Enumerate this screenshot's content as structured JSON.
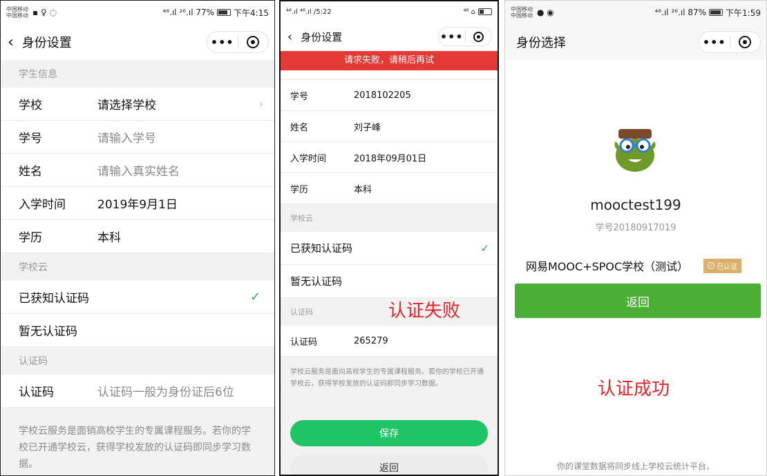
{
  "panel1": {
    "status": {
      "carrier_top": "中国移动",
      "carrier_bottom": "中国移动",
      "right": "⁴⁶.ıl ²⁶.ıl 77%",
      "time": "下午4:15"
    },
    "nav": {
      "title": "身份设置"
    },
    "student_section": {
      "title": "学生信息",
      "school": {
        "label": "学校",
        "value": "请选择学校"
      },
      "student_id": {
        "label": "学号",
        "placeholder": "请输入学号"
      },
      "name": {
        "label": "姓名",
        "placeholder": "请输入真实姓名"
      },
      "enroll": {
        "label": "入学时间",
        "value": "2019年9月1日"
      },
      "degree": {
        "label": "学历",
        "value": "本科"
      }
    },
    "cloud_section": {
      "title": "学校云",
      "option_have": "已获知认证码",
      "option_none": "暂无认证码"
    },
    "code_section": {
      "title": "认证码",
      "label": "认证码",
      "placeholder": "认证码一般为身份证后6位"
    },
    "description": "学校云服务是面销高校学生的专属课程服务。若你的学校已开通学校云，获得学校发放的认证码即同步学习数据。"
  },
  "panel2": {
    "status": {
      "left": "⁴⁶.ıl ⁴⁶.ıl /5:22",
      "right": "⁴⁶ ⌂",
      "time": ""
    },
    "nav": {
      "title": "身份设置"
    },
    "error_message": "请求失败，请稍后再试",
    "student_id": {
      "label": "学号",
      "value": "2018102205"
    },
    "name": {
      "label": "姓名",
      "value": "刘子峰"
    },
    "enroll": {
      "label": "入学时间",
      "value": "2018年09月01日"
    },
    "degree": {
      "label": "学历",
      "value": "本科"
    },
    "cloud_section": {
      "title": "学校云",
      "option_have": "已获知认证码",
      "option_none": "暂无认证码"
    },
    "code_section": {
      "title": "认证码",
      "label": "认证码",
      "value": "265279"
    },
    "description": "学校云服务是面向高校学生的专属课程服务。若你的学校已开通学校云，获得学校发放的认证码即同步学习数据。",
    "save_label": "保存",
    "back_label": "返回",
    "annotation": "认证失败"
  },
  "panel3": {
    "status": {
      "carrier_top": "中国移动",
      "carrier_bottom": "中国移动",
      "right": "⁴⁶.ıl ²⁶.ıl 87%",
      "time": "下午1:59"
    },
    "nav": {
      "title": "身份选择"
    },
    "username": "mooctest199",
    "student_id": "学号20180917019",
    "school": "网易MOOC+SPOC学校（测试）",
    "badge": "已认证",
    "return_label": "返回",
    "annotation": "认证成功",
    "footer": "你的课堂数据将同步线上学校云统计平台。"
  },
  "colors": {
    "green_check": "#22b14c",
    "save_green": "#1fc465",
    "return_green": "#4caf35",
    "error_red": "#e53935",
    "annotation_red": "#e8212b",
    "badge_gold": "#dab06a"
  }
}
